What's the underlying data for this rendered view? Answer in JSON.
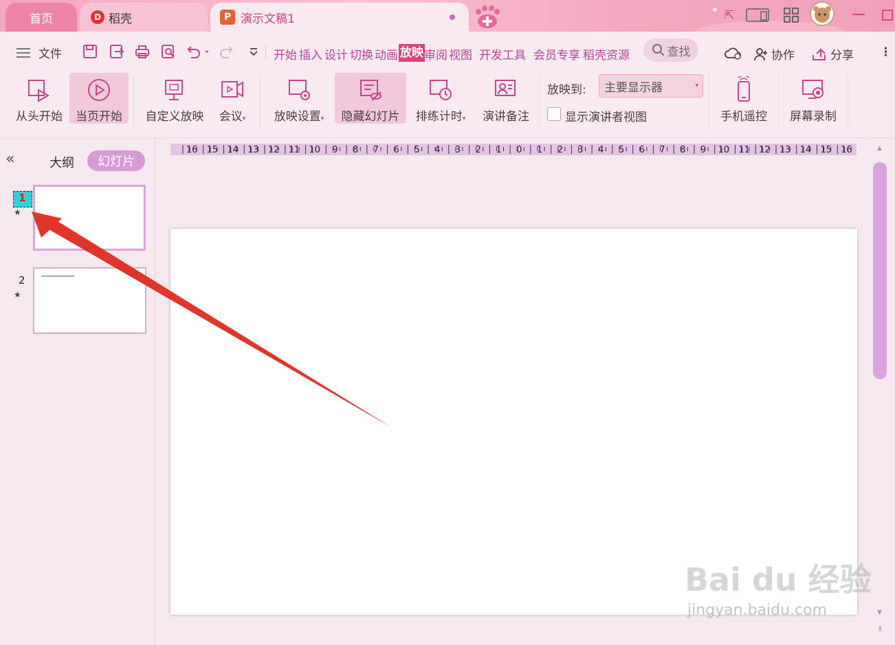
{
  "tabs": {
    "home": "首页",
    "daoke": "稻壳",
    "document": "演示文稿1"
  },
  "menu": {
    "file": "文件",
    "items": [
      "开始",
      "插入",
      "设计",
      "切换",
      "动画",
      "放映",
      "审阅",
      "视图",
      "开发工具",
      "会员专享",
      "稻壳资源"
    ],
    "active": "放映",
    "search": "查找",
    "collaborate": "协作",
    "share": "分享"
  },
  "ribbon": {
    "from_start": "从头开始",
    "from_current": "当页开始",
    "custom_show": "自定义放映",
    "meeting": "会议",
    "show_settings": "放映设置",
    "hide_slide": "隐藏幻灯片",
    "rehearse": "排练计时",
    "speaker_notes": "演讲备注",
    "display_label": "放映到:",
    "display_value": "主要显示器",
    "presenter_view": "显示演讲者视图",
    "phone_remote": "手机遥控",
    "screen_record": "屏幕录制"
  },
  "leftpane": {
    "outline_tab": "大纲",
    "slides_tab": "幻灯片",
    "slides": [
      {
        "num": "1",
        "star": "★"
      },
      {
        "num": "2",
        "star": "★"
      }
    ]
  },
  "ruler": {
    "ticks": [
      "16",
      "15",
      "14",
      "13",
      "12",
      "11",
      "10",
      "9",
      "8",
      "7",
      "6",
      "5",
      "4",
      "3",
      "2",
      "1",
      "0",
      "1",
      "2",
      "3",
      "4",
      "5",
      "6",
      "7",
      "8",
      "9",
      "10",
      "11",
      "12",
      "13",
      "14",
      "15",
      "16"
    ]
  },
  "watermark": {
    "brand": "Bai du 经验",
    "url": "jingyan.baidu.com"
  },
  "colors": {
    "accent": "#d4477d",
    "menu_text": "#b5459a",
    "arrow": "#e0352b"
  }
}
